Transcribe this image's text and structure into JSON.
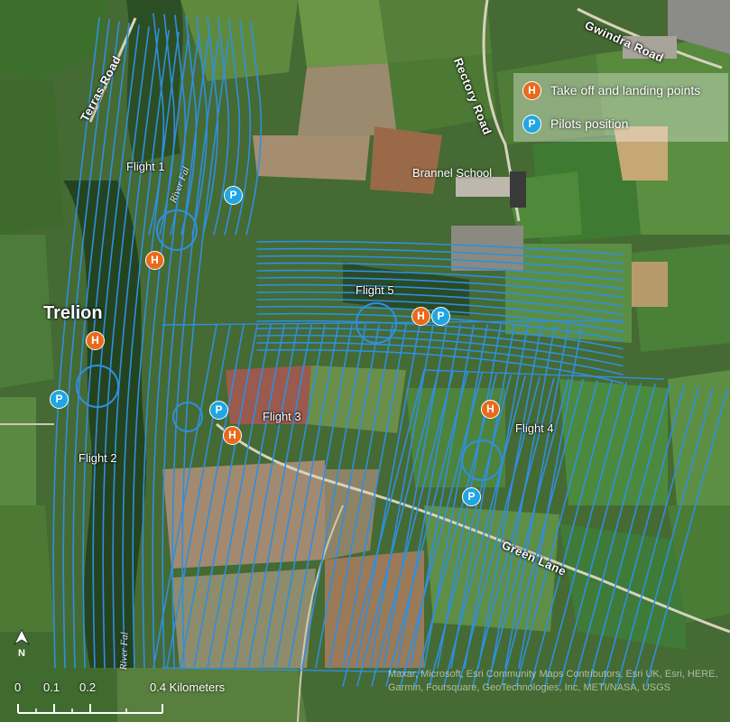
{
  "map": {
    "place": "Trelion",
    "school": "Brannel School",
    "roads": [
      "Terras Road",
      "Rectory Road",
      "Gwindra Road",
      "Green Lane"
    ],
    "rivers": [
      "River Fal",
      "River Fal"
    ],
    "flights": [
      "Flight 1",
      "Flight 2",
      "Flight 3",
      "Flight 4",
      "Flight 5"
    ],
    "marker_h": "H",
    "marker_p": "P"
  },
  "legend": {
    "items": [
      {
        "symbol": "H",
        "label": "Take off and landing points",
        "color": "#e96a1c"
      },
      {
        "symbol": "P",
        "label": "Pilots position",
        "color": "#21a5e3"
      }
    ]
  },
  "scale": {
    "ticks": [
      "0",
      "0.1",
      "0.2",
      "0.4 Kilometers"
    ]
  },
  "north": "N",
  "attribution": "Maxar, Microsoft, Esri Community Maps Contributors, Esri UK, Esri, HERE, Garmin, Foursquare, GeoTechnologies, Inc, METI/NASA, USGS",
  "colors": {
    "flight_path": "#2f8fe0",
    "takeoff": "#e96a1c",
    "pilot": "#21a5e3"
  }
}
